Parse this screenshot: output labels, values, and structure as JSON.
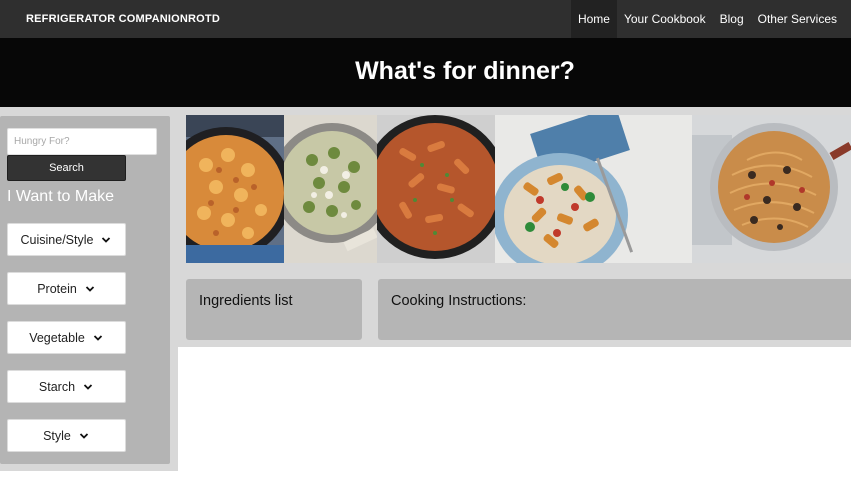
{
  "navbar": {
    "brand": "REFRIGERATOR COMPANION",
    "rotd": "ROTD",
    "links": [
      "Home",
      "Your Cookbook",
      "Blog",
      "Other Services"
    ],
    "active": "Home"
  },
  "hero": {
    "title": "What's for dinner?"
  },
  "sidebar": {
    "search_placeholder": "Hungry For?",
    "search_value": "",
    "search_button": "Search",
    "heading": "I Want to Make",
    "filters": [
      {
        "label": "Cuisine/Style"
      },
      {
        "label": "Protein"
      },
      {
        "label": "Vegetable"
      },
      {
        "label": "Starch"
      },
      {
        "label": "Style"
      }
    ]
  },
  "gallery": {
    "images": [
      {
        "icon": "shells-skillet-image"
      },
      {
        "icon": "fusilli-pesto-image"
      },
      {
        "icon": "penne-skillet-image"
      },
      {
        "icon": "rotini-bowl-image"
      },
      {
        "icon": "spaghetti-pan-image"
      }
    ]
  },
  "panels": {
    "ingredients_title": "Ingredients list",
    "instructions_title": "Cooking Instructions:"
  },
  "colors": {
    "navbar": "#2f2f2f",
    "hero": "#070707",
    "band": "#d8d8d8",
    "sidebar": "#b4b4b4",
    "panel": "#b5b5b5",
    "button": "#333333"
  }
}
